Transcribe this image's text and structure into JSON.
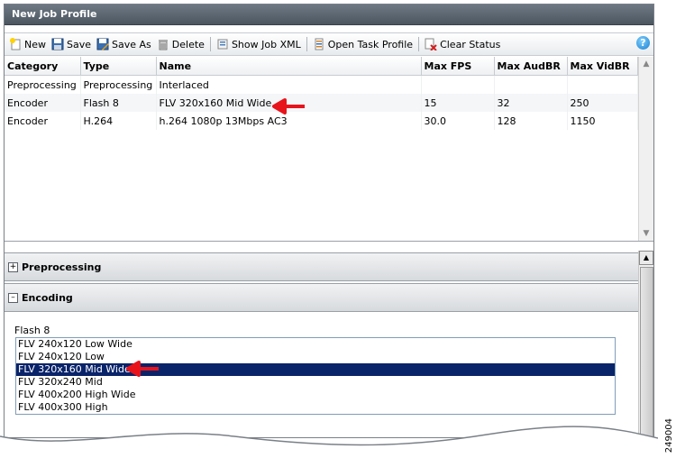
{
  "window": {
    "title": "New Job Profile"
  },
  "toolbar": {
    "new": "New",
    "save": "Save",
    "save_as": "Save As",
    "delete": "Delete",
    "show_job_xml": "Show Job XML",
    "open_task_profile": "Open Task Profile",
    "clear_status": "Clear Status",
    "help": "?"
  },
  "grid": {
    "columns": [
      "Category",
      "Type",
      "Name",
      "Max FPS",
      "Max AudBR",
      "Max VidBR"
    ],
    "rows": [
      [
        "Preprocessing",
        "Preprocessing",
        "Interlaced",
        "",
        "",
        ""
      ],
      [
        "Encoder",
        "Flash 8",
        "FLV 320x160 Mid Wide",
        "15",
        "32",
        "250"
      ],
      [
        "Encoder",
        "H.264",
        "h.264 1080p 13Mbps AC3",
        "30.0",
        "128",
        "1150"
      ]
    ]
  },
  "panels": {
    "preprocessing": "Preprocessing",
    "encoding": "Encoding"
  },
  "encoding": {
    "type_label": "Flash 8",
    "options": [
      "FLV 240x120 Low Wide",
      "FLV 240x120 Low",
      "FLV 320x160 Mid Wide",
      "FLV 320x240 Mid",
      "FLV 400x200 High Wide",
      "FLV 400x300 High"
    ],
    "selected_index": 2
  },
  "figure_id": "249004",
  "colors": {
    "selection": "#0a246a",
    "callout_arrow": "#e8141c",
    "titlebar": "#5a646e"
  }
}
